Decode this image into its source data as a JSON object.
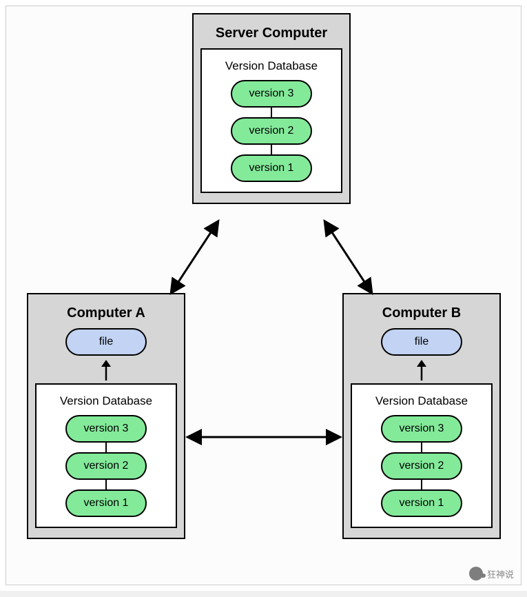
{
  "server": {
    "title": "Server Computer",
    "vdb_title": "Version Database",
    "versions": {
      "v3": "version 3",
      "v2": "version 2",
      "v1": "version 1"
    }
  },
  "computer_a": {
    "title": "Computer A",
    "file_label": "file",
    "vdb_title": "Version Database",
    "versions": {
      "v3": "version 3",
      "v2": "version 2",
      "v1": "version 1"
    }
  },
  "computer_b": {
    "title": "Computer B",
    "file_label": "file",
    "vdb_title": "Version Database",
    "versions": {
      "v3": "version 3",
      "v2": "version 2",
      "v1": "version 1"
    }
  },
  "watermark": {
    "text": "狂神说"
  }
}
